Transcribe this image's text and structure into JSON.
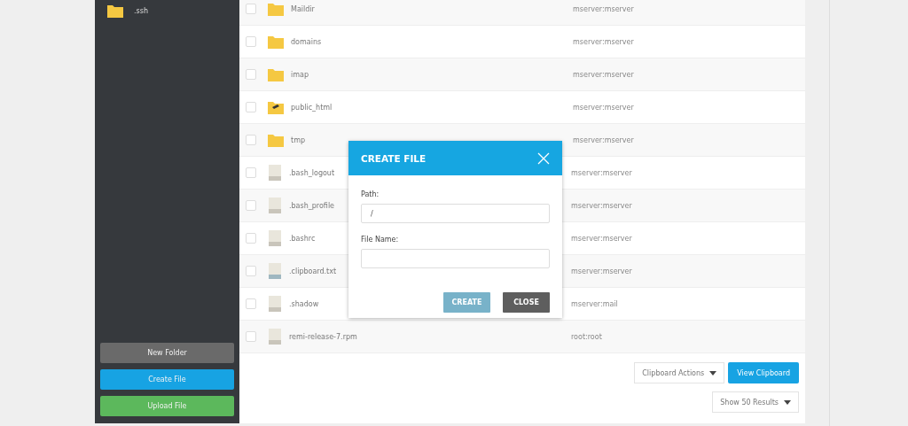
{
  "sidebar": {
    "tree_items": [
      {
        "label": ".ssh",
        "kind": "folder"
      }
    ],
    "buttons": [
      {
        "label": "New Folder",
        "kind": "neutral"
      },
      {
        "label": "Create File",
        "kind": "primary"
      },
      {
        "label": "Upload File",
        "kind": "success"
      }
    ]
  },
  "files": [
    {
      "name": "Maildir",
      "kind": "folder",
      "owner": "mserver:mserver",
      "checked": false
    },
    {
      "name": "domains",
      "kind": "folder",
      "owner": "mserver:mserver",
      "checked": false
    },
    {
      "name": "imap",
      "kind": "folder",
      "owner": "mserver:mserver",
      "checked": false
    },
    {
      "name": "public_html",
      "kind": "webfolder",
      "owner": "mserver:mserver",
      "checked": false
    },
    {
      "name": "tmp",
      "kind": "folder",
      "owner": "mserver:mserver",
      "checked": false
    },
    {
      "name": ".bash_logout",
      "kind": "file",
      "owner": "mserver:mserver",
      "checked": false
    },
    {
      "name": ".bash_profile",
      "kind": "file",
      "owner": "mserver:mserver",
      "checked": false
    },
    {
      "name": ".bashrc",
      "kind": "file",
      "owner": "mserver:mserver",
      "checked": false
    },
    {
      "name": ".clipboard.txt",
      "kind": "textfile",
      "owner": "mserver:mserver",
      "checked": false
    },
    {
      "name": ".shadow",
      "kind": "file",
      "owner": "mserver:mail",
      "checked": false
    },
    {
      "name": "remi-release-7.rpm",
      "kind": "file",
      "owner": "root:root",
      "checked": false
    }
  ],
  "toolbar": {
    "clipboard_dropdown": "Clipboard Actions",
    "view_button": "View Clipboard",
    "page_size_dropdown": "Show 50 Results"
  },
  "dialog": {
    "title": "CREATE FILE",
    "fields": [
      {
        "label": "Path:",
        "value": "/"
      },
      {
        "label": "File Name:"
      }
    ],
    "buttons": [
      {
        "label": "CREATE",
        "kind": "primary",
        "disabled": true
      },
      {
        "label": "CLOSE",
        "kind": "secondary",
        "disabled": false
      }
    ]
  }
}
